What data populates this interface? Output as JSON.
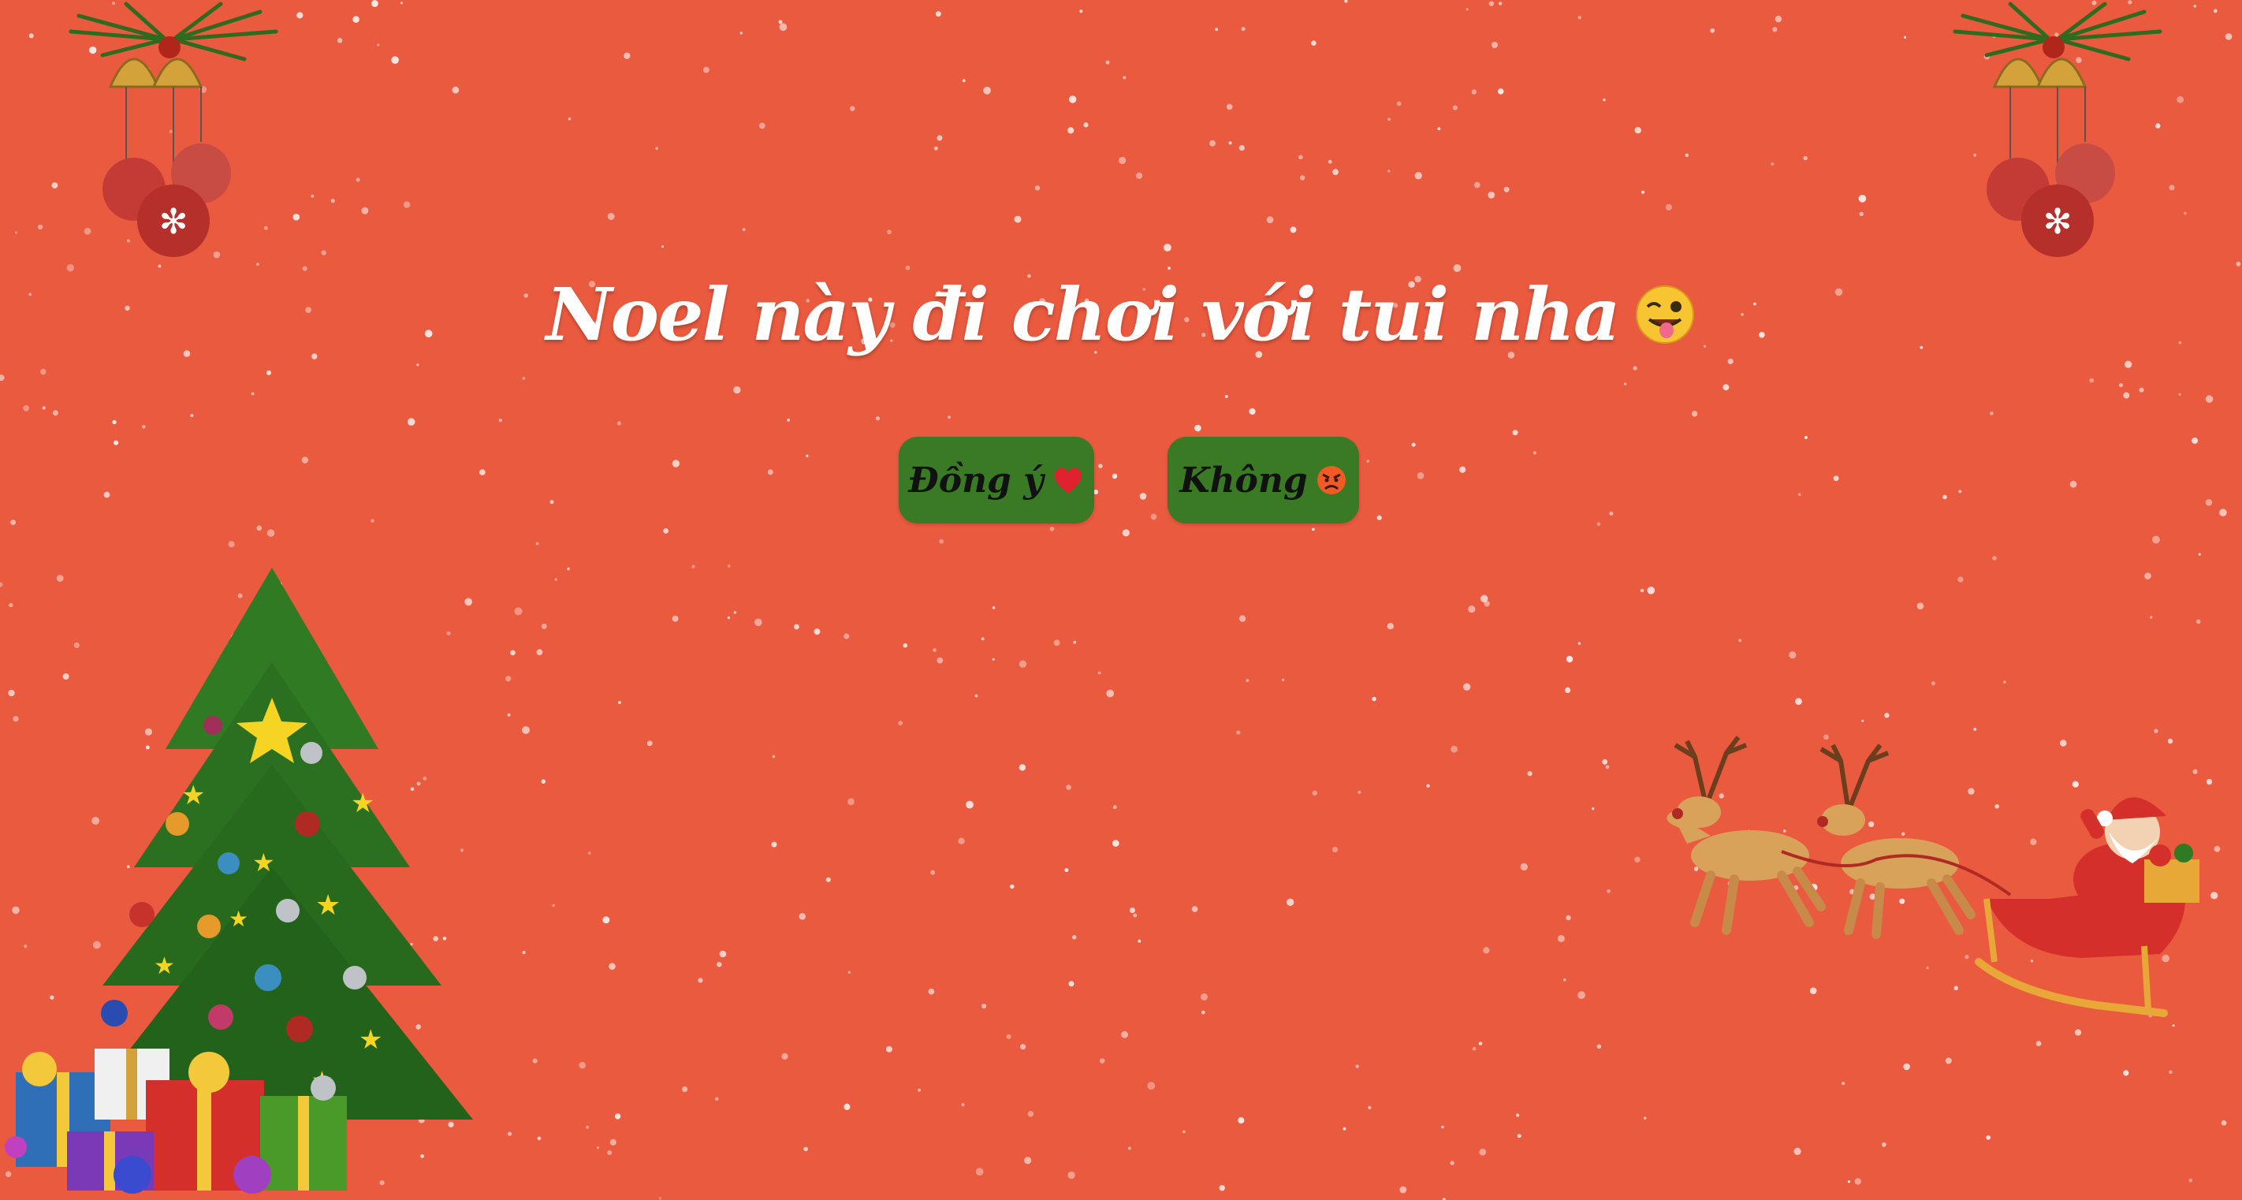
{
  "title": {
    "text": "Noel này đi chơi với tui nha",
    "emoji": "winking-face-with-tongue-icon"
  },
  "buttons": {
    "yes": {
      "label": "Đồng ý",
      "icon": "red-heart-icon"
    },
    "no": {
      "label": "Không",
      "icon": "angry-face-icon"
    }
  },
  "colors": {
    "background": "#ea5a3f",
    "button": "#3b7a24",
    "title_text": "#ffffff",
    "button_text": "#111111"
  },
  "decorations": [
    "christmas-bells-ornament-left",
    "christmas-bells-ornament-right",
    "christmas-tree-with-gifts",
    "santa-sleigh-with-reindeer",
    "falling-snow"
  ]
}
